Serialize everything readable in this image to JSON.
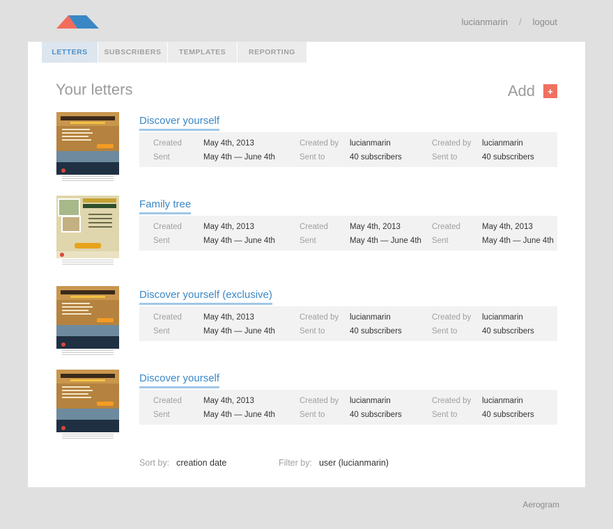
{
  "user": {
    "name": "lucianmarin",
    "separator": "/",
    "logout": "logout"
  },
  "tabs": [
    {
      "label": "Letters",
      "active": true
    },
    {
      "label": "Subscribers",
      "active": false
    },
    {
      "label": "Templates",
      "active": false
    },
    {
      "label": "Reporting",
      "active": false
    }
  ],
  "page": {
    "heading": "Your letters",
    "add_label": "Add",
    "add_icon": "+"
  },
  "letters": [
    {
      "title": "Discover yourself",
      "thumb": "discover",
      "rows": [
        [
          "Created",
          "May 4th, 2013",
          "Created by",
          "lucianmarin",
          "Created by",
          "lucianmarin"
        ],
        [
          "Sent",
          "May 4th — June 4th",
          "Sent to",
          "40 subscribers",
          "Sent to",
          "40 subscribers"
        ]
      ]
    },
    {
      "title": "Family tree",
      "thumb": "family",
      "rows": [
        [
          "Created",
          "May 4th, 2013",
          "Created",
          "May 4th, 2013",
          "Created",
          "May 4th, 2013"
        ],
        [
          "Sent",
          "May 4th — June 4th",
          "Sent",
          "May 4th — June 4th",
          "Sent",
          "May 4th — June 4th"
        ]
      ]
    },
    {
      "title": "Discover yourself (exclusive)",
      "thumb": "discover",
      "rows": [
        [
          "Created",
          "May 4th, 2013",
          "Created by",
          "lucianmarin",
          "Created by",
          "lucianmarin"
        ],
        [
          "Sent",
          "May 4th — June 4th",
          "Sent to",
          "40 subscribers",
          "Sent to",
          "40 subscribers"
        ]
      ]
    },
    {
      "title": "Discover yourself",
      "thumb": "discover",
      "rows": [
        [
          "Created",
          "May 4th, 2013",
          "Created by",
          "lucianmarin",
          "Created by",
          "lucianmarin"
        ],
        [
          "Sent",
          "May 4th — June 4th",
          "Sent to",
          "40 subscribers",
          "Sent to",
          "40 subscribers"
        ]
      ]
    }
  ],
  "sort": {
    "label": "Sort by:",
    "value": "creation date"
  },
  "filter": {
    "label": "Filter by:",
    "value": "user (lucianmarin)"
  },
  "footer": {
    "brand": "Aerogram"
  },
  "colors": {
    "accent": "#3a87c6",
    "add_button": "#f07060",
    "logo_red": "#f26b5b",
    "logo_blue": "#3a87c6"
  },
  "icons": {
    "logo": "aerogram-logo",
    "add": "plus-icon"
  }
}
